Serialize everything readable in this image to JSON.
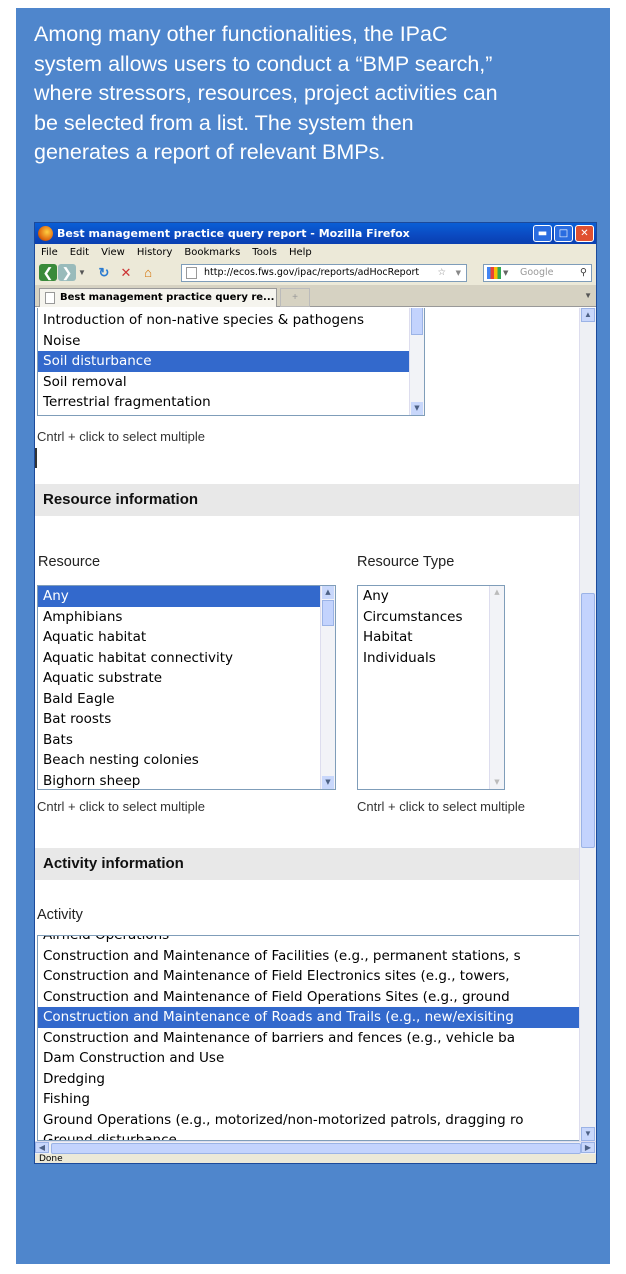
{
  "caption": {
    "lines": [
      "Among many other functionalities, the IPaC",
      "system allows users to conduct a “BMP search,”",
      "where stressors, resources, project activities can",
      "be selected from a list. The system then",
      "generates a report of relevant BMPs."
    ]
  },
  "window": {
    "title": "Best management practice query report - Mozilla Firefox"
  },
  "menu": [
    "File",
    "Edit",
    "View",
    "History",
    "Bookmarks",
    "Tools",
    "Help"
  ],
  "nav": {
    "url": "http://ecos.fws.gov/ipac/reports/adHocReport",
    "search_placeholder": "Google"
  },
  "tab": {
    "label": "Best management practice query re...",
    "new_tab": "+"
  },
  "stressor": {
    "items": [
      "Introduction of non-native species & pathogens",
      "Noise",
      "Soil disturbance",
      "Soil removal",
      "Terrestrial fragmentation"
    ],
    "selected": "Soil disturbance",
    "hint": "Cntrl + click to select multiple"
  },
  "resource_section": {
    "heading": "Resource information",
    "resource_label": "Resource",
    "type_label": "Resource Type",
    "resources": [
      "Any",
      "Amphibians",
      "Aquatic habitat",
      "Aquatic habitat connectivity",
      "Aquatic substrate",
      "Bald Eagle",
      "Bat roosts",
      "Bats",
      "Beach nesting colonies",
      "Bighorn sheep"
    ],
    "resource_selected": "Any",
    "types": [
      "Any",
      "Circumstances",
      "Habitat",
      "Individuals"
    ],
    "hint": "Cntrl + click to select multiple"
  },
  "activity_section": {
    "heading": "Activity information",
    "label": "Activity",
    "items": [
      "Airfield Operations",
      "Construction and Maintenance of Facilities (e.g., permanent stations, s",
      "Construction and Maintenance of Field Electronics sites (e.g., towers,",
      "Construction and Maintenance of Field Operations Sites (e.g., ground",
      "Construction and Maintenance of Roads and Trails (e.g., new/exisiting",
      "Construction and Maintenance of barriers and fences (e.g., vehicle ba",
      "Dam Construction and Use",
      "Dredging",
      "Fishing",
      "Ground Operations (e.g., motorized/non-motorized patrols, dragging ro",
      "Ground disturbance"
    ],
    "selected": "Construction and Maintenance of Roads and Trails (e.g., new/exisiting"
  },
  "status": "Done",
  "colors": {
    "panel": "#4f86cc",
    "selection": "#3369cc",
    "titlebar": "#0b49c0"
  }
}
